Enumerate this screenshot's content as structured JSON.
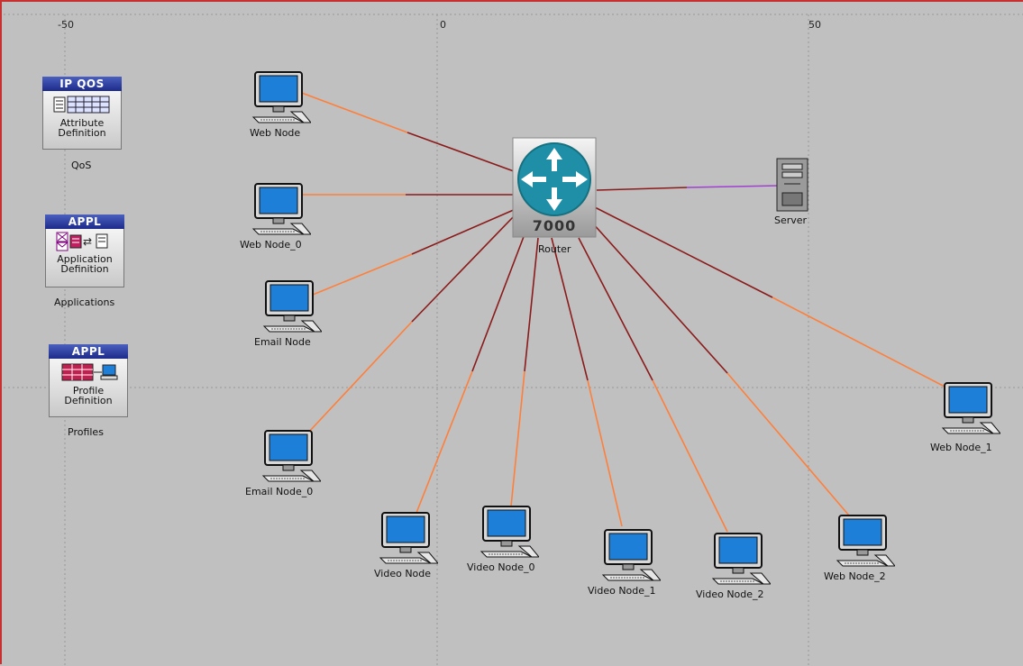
{
  "axis": {
    "ticks": [
      "-50",
      "0",
      "50"
    ]
  },
  "palette": {
    "background": "#c0c0c0",
    "link_orange": "#ff7f3a",
    "link_dark": "#8b1a1a",
    "link_purple": "#a040d0",
    "monitor_blue": "#1e7fd8",
    "router_teal": "#1f8fa8"
  },
  "objects": {
    "qos": {
      "header": "IP QOS",
      "body_line1": "Attribute",
      "body_line2": "Definition",
      "caption": "QoS",
      "icon": "table-icon"
    },
    "applications": {
      "header": "APPL",
      "body_line1": "Application",
      "body_line2": "Definition",
      "caption": "Applications",
      "icon": "app-icons"
    },
    "profiles": {
      "header": "APPL",
      "body_line1": "Profile",
      "body_line2": "Definition",
      "caption": "Profiles",
      "icon": "profile-icon"
    }
  },
  "router": {
    "model": "7000",
    "label": "Router"
  },
  "server": {
    "label": "Server"
  },
  "workstations": [
    {
      "label": "Web Node"
    },
    {
      "label": "Web Node_0"
    },
    {
      "label": "Email Node"
    },
    {
      "label": "Email Node_0"
    },
    {
      "label": "Video Node"
    },
    {
      "label": "Video Node_0"
    },
    {
      "label": "Video Node_1"
    },
    {
      "label": "Video Node_2"
    },
    {
      "label": "Web Node_2"
    },
    {
      "label": "Web Node_1"
    }
  ]
}
